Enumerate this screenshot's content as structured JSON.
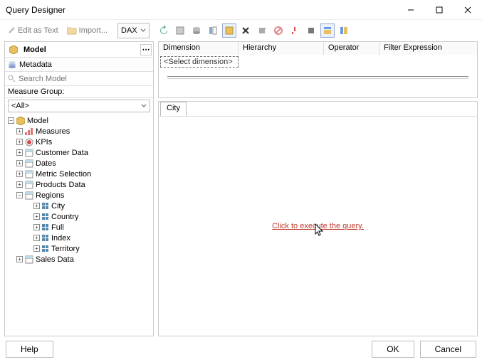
{
  "title": "Query Designer",
  "toolbar": {
    "edit_as_text": "Edit as Text",
    "import": "Import...",
    "lang": "DAX"
  },
  "left": {
    "model_label": "Model",
    "metadata_label": "Metadata",
    "search_placeholder": "Search Model",
    "measure_group_label": "Measure Group:",
    "measure_group_value": "<All>",
    "tree": {
      "root": "Model",
      "measures": "Measures",
      "kpis": "KPIs",
      "customer": "Customer Data",
      "dates": "Dates",
      "metric": "Metric Selection",
      "products": "Products Data",
      "regions": "Regions",
      "city": "City",
      "country": "Country",
      "full": "Full",
      "index": "Index",
      "territory": "Territory",
      "sales": "Sales Data"
    }
  },
  "filter": {
    "col_dimension": "Dimension",
    "col_hierarchy": "Hierarchy",
    "col_operator": "Operator",
    "col_filter_expr": "Filter Expression",
    "sel_dim": "<Select dimension>"
  },
  "results": {
    "tab": "City",
    "execute_link": "Click to execute the query."
  },
  "footer": {
    "help": "Help",
    "ok": "OK",
    "cancel": "Cancel"
  }
}
